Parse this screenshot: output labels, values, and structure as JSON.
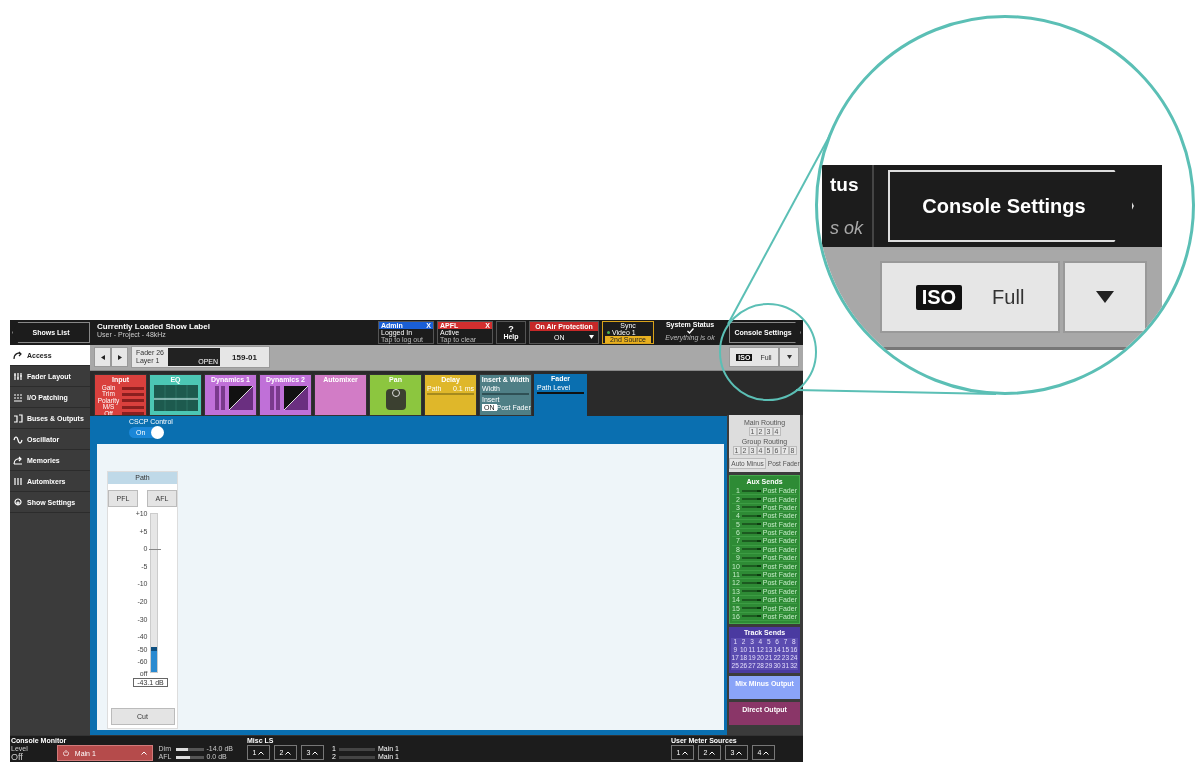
{
  "header": {
    "back_button": "Shows List",
    "show_title": "Currently Loaded Show Label",
    "show_subtitle": "User - Project - 48kHz",
    "status_boxes": [
      {
        "title": "Admin",
        "close": "X",
        "line1": "Logged In",
        "line2": "Tap to log out",
        "color": "#1a5fd6"
      },
      {
        "title": "APFL",
        "close": "X",
        "line1": "Active",
        "line2": "Tap to clear",
        "color": "#d32f2f"
      }
    ],
    "help": {
      "icon": "?",
      "label": "Help"
    },
    "on_air": {
      "title": "On Air Protection",
      "value": "ON"
    },
    "sync": {
      "title": "Sync",
      "source": "Video 1",
      "badge": "2nd Source"
    },
    "system_status": {
      "title": "System Status",
      "message": "Everything is ok"
    },
    "console_settings": "Console Settings"
  },
  "sidebar": [
    {
      "label": "Access",
      "kind": "access",
      "selected": true
    },
    {
      "label": "Fader Layout",
      "kind": "layout",
      "selected": false
    },
    {
      "label": "I/O Patching",
      "kind": "patching",
      "selected": false
    },
    {
      "label": "Buses & Outputs",
      "kind": "buses",
      "selected": false
    },
    {
      "label": "Oscillator",
      "kind": "oscillator",
      "selected": false
    },
    {
      "label": "Memories",
      "kind": "memories",
      "selected": false
    },
    {
      "label": "Automixers",
      "kind": "automixers",
      "selected": false
    },
    {
      "label": "Show Settings",
      "kind": "settings",
      "selected": false
    }
  ],
  "toolbar": {
    "fader": "Fader 26",
    "layer": "Layer 1",
    "display_tag": "OPEN",
    "path_label": "159-01",
    "iso": "ISO",
    "mode": "Full"
  },
  "tiles": [
    {
      "title": "Input",
      "kind": "input",
      "color": "#d9403d",
      "selected": false,
      "lines": [
        "Gain",
        "Trim",
        "Polarity",
        "M/S",
        "Off"
      ]
    },
    {
      "title": "EQ",
      "kind": "eq",
      "color": "#4cc7b4",
      "selected": false
    },
    {
      "title": "Dynamics 1",
      "kind": "dynamics",
      "color": "#c070d8",
      "selected": false
    },
    {
      "title": "Dynamics 2",
      "kind": "dynamics",
      "color": "#c070d8",
      "selected": false
    },
    {
      "title": "Automixer",
      "kind": "plain",
      "color": "#d27cc6",
      "selected": false
    },
    {
      "title": "Pan",
      "kind": "pan",
      "color": "#8cc63f",
      "selected": false
    },
    {
      "title": "Delay",
      "kind": "delay",
      "color": "#dfb72a",
      "selected": false,
      "lines": [
        "Path",
        "0.1 ms"
      ]
    },
    {
      "title": "Insert & Width",
      "kind": "insert",
      "color": "#4f7f86",
      "selected": false,
      "lines": [
        "Width",
        "Insert",
        "ON",
        "Post Fader"
      ]
    },
    {
      "title": "Fader",
      "kind": "fader",
      "color": "#0a6fb0",
      "selected": true,
      "lines": [
        "Path Level"
      ]
    }
  ],
  "cscp": {
    "label": "CSCP Control",
    "toggle": "On",
    "on": true
  },
  "path_strip": {
    "title": "Path",
    "buttons": [
      {
        "label": "PFL",
        "selected": false
      },
      {
        "label": "AFL",
        "selected": false
      }
    ],
    "scale": [
      "+10",
      "+5",
      "0",
      "-5",
      "-10",
      "-20",
      "-30",
      "-40",
      "-50",
      "-60",
      "off"
    ],
    "level": 0.16,
    "value": "-43.1",
    "unit": "dB",
    "cut": "Cut"
  },
  "routing": {
    "main_title": "Main Routing",
    "main": [
      "1",
      "2",
      "3",
      "4"
    ],
    "group_title": "Group Routing",
    "group": [
      "1",
      "2",
      "3",
      "4",
      "5",
      "6",
      "7",
      "8"
    ],
    "auto_minus": "Auto Minus",
    "post_fader": "Post Fader"
  },
  "aux_sends": {
    "title": "Aux Sends",
    "rows": [
      {
        "number": "1",
        "mode": "Post Fader"
      },
      {
        "number": "2",
        "mode": "Post Fader"
      },
      {
        "number": "3",
        "mode": "Post Fader"
      },
      {
        "number": "4",
        "mode": "Post Fader"
      },
      {
        "number": "5",
        "mode": "Post Fader"
      },
      {
        "number": "6",
        "mode": "Post Fader"
      },
      {
        "number": "7",
        "mode": "Post Fader"
      },
      {
        "number": "8",
        "mode": "Post Fader"
      },
      {
        "number": "9",
        "mode": "Post Fader"
      },
      {
        "number": "10",
        "mode": "Post Fader"
      },
      {
        "number": "11",
        "mode": "Post Fader"
      },
      {
        "number": "12",
        "mode": "Post Fader"
      },
      {
        "number": "13",
        "mode": "Post Fader"
      },
      {
        "number": "14",
        "mode": "Post Fader"
      },
      {
        "number": "15",
        "mode": "Post Fader"
      },
      {
        "number": "16",
        "mode": "Post Fader"
      }
    ]
  },
  "track_sends": {
    "title": "Track Sends",
    "buttons": [
      "1",
      "2",
      "3",
      "4",
      "5",
      "6",
      "7",
      "8",
      "9",
      "10",
      "11",
      "12",
      "13",
      "14",
      "15",
      "16",
      "17",
      "18",
      "19",
      "20",
      "21",
      "22",
      "23",
      "24",
      "25",
      "26",
      "27",
      "28",
      "29",
      "30",
      "31",
      "32"
    ]
  },
  "mix_minus": "Mix Minus Output",
  "direct_output": "Direct Output",
  "bottom": {
    "console_monitor": {
      "title": "Console Monitor",
      "level_label": "Level",
      "level_value": "Off",
      "selector": "Main 1",
      "meters": [
        {
          "label": "Dim",
          "level": 0.45,
          "reading": "-14.0 dB"
        },
        {
          "label": "AFL",
          "level": 0.5,
          "reading": "0.0 dB"
        }
      ]
    },
    "misc_ls": {
      "title": "Misc LS",
      "buttons": [
        "1",
        "2",
        "3"
      ],
      "rows": [
        {
          "number": "1",
          "source": "Main 1"
        },
        {
          "number": "2",
          "source": "Main 1"
        }
      ]
    },
    "user_meter_sources": {
      "title": "User Meter Sources",
      "buttons": [
        "1",
        "2",
        "3",
        "4"
      ]
    }
  },
  "magnifier": {
    "status_fragment": "tus",
    "message_fragment": "s ok",
    "console_settings": "Console Settings",
    "iso": "ISO",
    "mode": "Full"
  }
}
